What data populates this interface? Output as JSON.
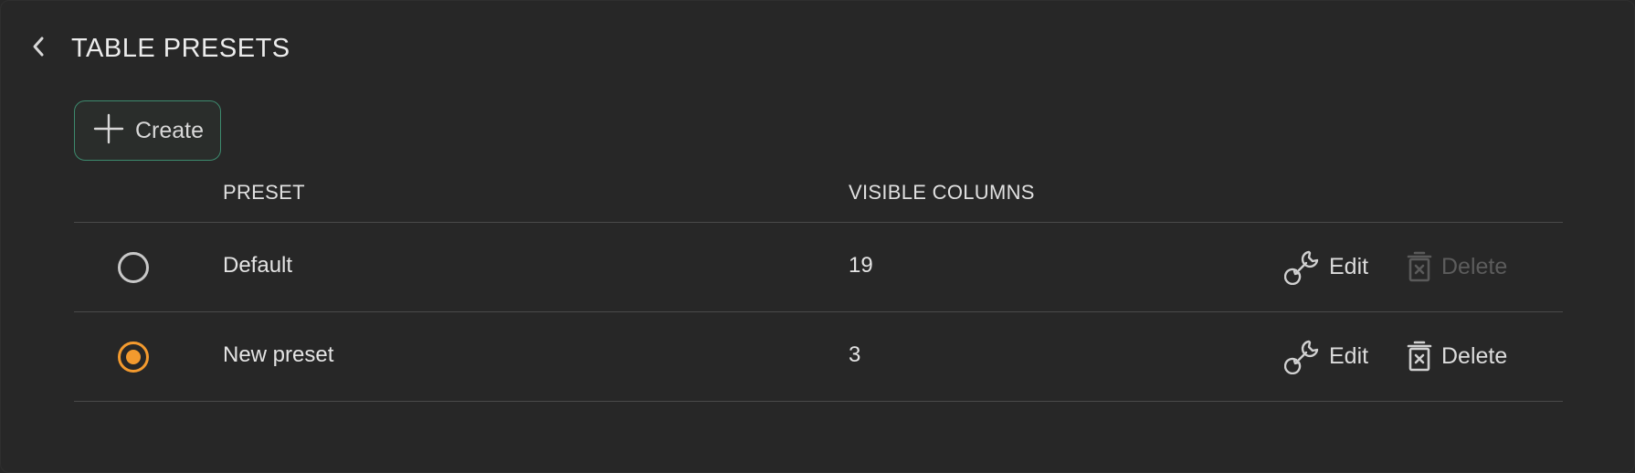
{
  "header": {
    "title": "TABLE PRESETS",
    "back_icon": "chevron-left-icon"
  },
  "toolbar": {
    "create_label": "Create",
    "create_icon": "plus-icon"
  },
  "table": {
    "columns": [
      "PRESET",
      "VISIBLE COLUMNS"
    ],
    "rows": [
      {
        "name": "Default",
        "visible_columns": "19",
        "selected": false,
        "edit_label": "Edit",
        "delete_label": "Delete",
        "delete_enabled": false
      },
      {
        "name": "New preset",
        "visible_columns": "3",
        "selected": true,
        "edit_label": "Edit",
        "delete_label": "Delete",
        "delete_enabled": true
      }
    ]
  },
  "colors": {
    "background": "#272727",
    "accent_selected": "#f39a2e",
    "create_border": "#3d8a6e",
    "disabled_text": "#5c5c5c"
  }
}
